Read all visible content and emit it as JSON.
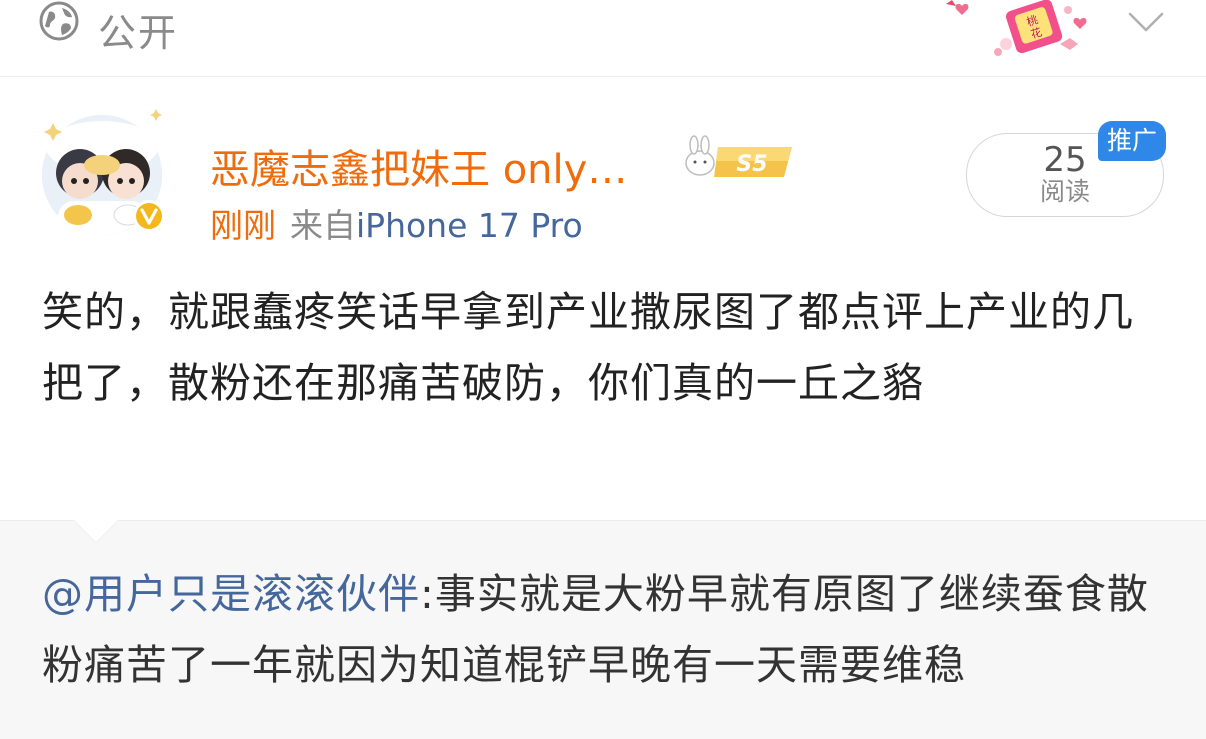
{
  "header": {
    "visibility_label": "公开",
    "globe_icon": "globe-icon",
    "sticker": "decorative-sticker",
    "expand_icon": "chevron-down-icon"
  },
  "post": {
    "author_name": "恶魔志鑫把妹王 only…",
    "level_badge": "S5",
    "time": "刚刚",
    "source_prefix": "来自",
    "device": "iPhone 17 Pro",
    "read_count": "25",
    "read_label": "阅读",
    "promo_tag": "推广",
    "verified_icon": "verified-badge-icon",
    "text": "笑的，就跟蠢疼笑话早拿到产业撒尿图了都点评上产业的几把了，散粉还在那痛苦破防，你们真的一丘之貉"
  },
  "repost": {
    "mention": "@用户只是滚滚伙伴",
    "separator": ":",
    "text": "事实就是大粉早就有原图了继续蚕食散粉痛苦了一年就因为知道棍铲早晚有一天需要维稳"
  },
  "colors": {
    "accent_orange": "#ef6b0c",
    "link_blue": "#45679b",
    "promo_blue": "#2f87e8",
    "muted_gray": "#8a8a8a"
  }
}
